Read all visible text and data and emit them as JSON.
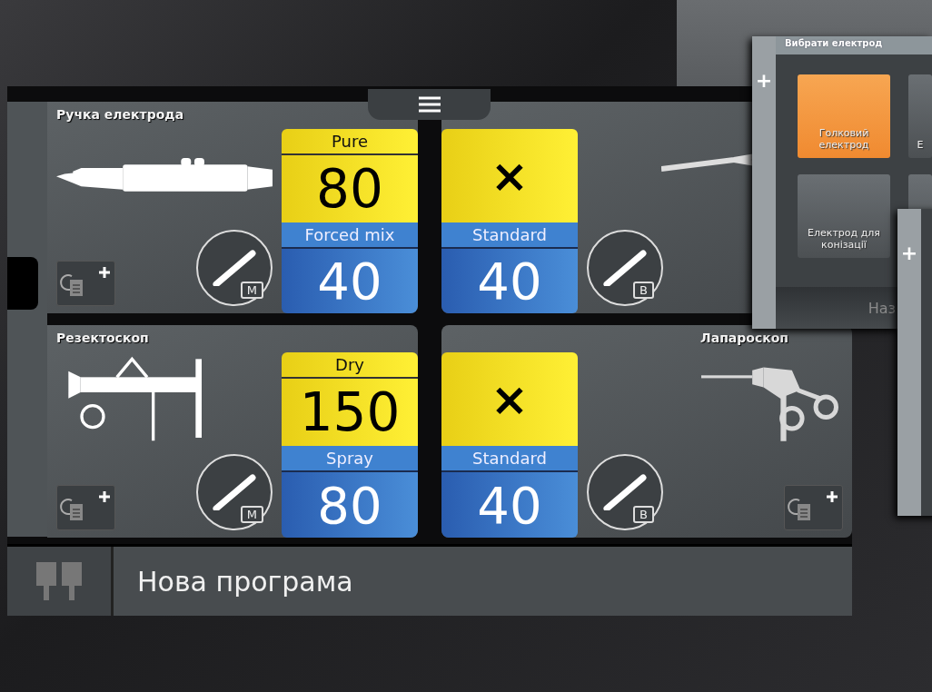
{
  "quadrants": [
    {
      "label": "Ручка електрода",
      "kind": "pen",
      "badge": "M",
      "upper": {
        "mode": "Pure",
        "value": "80"
      },
      "lower": {
        "mode": "Forced mix",
        "value": "40"
      }
    },
    {
      "kind": "scissors",
      "badge": "B",
      "upper": {
        "value": "×"
      },
      "lower": {
        "mode": "Standard",
        "value": "40"
      }
    },
    {
      "label": "Резектоскоп",
      "kind": "resectoscope",
      "badge": "M",
      "upper": {
        "mode": "Dry",
        "value": "150"
      },
      "lower": {
        "mode": "Spray",
        "value": "80"
      }
    },
    {
      "label": "Лапароскоп",
      "kind": "laparoscope",
      "badge": "B",
      "upper": {
        "value": "×"
      },
      "lower": {
        "mode": "Standard",
        "value": "40"
      }
    }
  ],
  "bottom_bar": {
    "title": "Нова програма"
  },
  "electrode_window": {
    "title": "Вибрати електрод",
    "side_button": "+",
    "footer": "Наз",
    "tiles": [
      {
        "label": "Голковий електрод",
        "selected": true
      },
      {
        "label": "Е",
        "selected": false
      },
      {
        "label": "Електрод для конізації",
        "selected": false
      },
      {
        "selected": false
      }
    ]
  },
  "back_window": {
    "side_button": "+"
  }
}
